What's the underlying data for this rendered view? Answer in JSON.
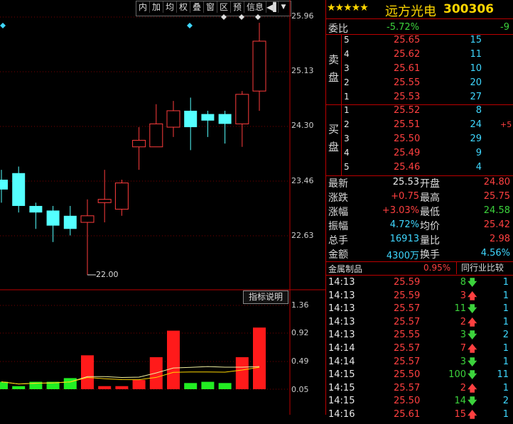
{
  "toolbar": {
    "buttons": [
      "内",
      "加",
      "均",
      "权",
      "叠",
      "窗",
      "区",
      "预",
      "信息"
    ],
    "arrow_label": "▼"
  },
  "chart": {
    "price_ticks": [
      "25.96",
      "25.13",
      "24.30",
      "23.46",
      "22.63"
    ],
    "low_label": "22.00",
    "vol_ticks": [
      "1.36",
      "0.92",
      "0.49",
      "0.05"
    ],
    "indicator_button": "指标说明"
  },
  "chart_data": {
    "type": "candlestick",
    "ylim": [
      22.0,
      25.96
    ],
    "candles": [
      {
        "open": 23.45,
        "close": 23.3,
        "high": 23.6,
        "low": 23.1
      },
      {
        "open": 23.55,
        "close": 23.05,
        "high": 23.65,
        "low": 22.95
      },
      {
        "open": 23.05,
        "close": 22.95,
        "high": 23.1,
        "low": 22.7
      },
      {
        "open": 22.98,
        "close": 22.75,
        "high": 23.05,
        "low": 22.5
      },
      {
        "open": 22.9,
        "close": 22.7,
        "high": 23.05,
        "low": 22.6
      },
      {
        "open": 22.8,
        "close": 22.9,
        "high": 23.15,
        "low": 22.0
      },
      {
        "open": 23.1,
        "close": 23.15,
        "high": 23.6,
        "low": 22.8
      },
      {
        "open": 23.0,
        "close": 23.4,
        "high": 23.45,
        "low": 22.9
      },
      {
        "open": 23.95,
        "close": 24.05,
        "high": 24.25,
        "low": 23.6
      },
      {
        "open": 23.95,
        "close": 24.3,
        "high": 24.6,
        "low": 23.95
      },
      {
        "open": 24.25,
        "close": 24.5,
        "high": 24.65,
        "low": 24.1
      },
      {
        "open": 24.5,
        "close": 24.25,
        "high": 24.7,
        "low": 23.9
      },
      {
        "open": 24.45,
        "close": 24.35,
        "high": 24.5,
        "low": 24.1
      },
      {
        "open": 24.45,
        "close": 24.3,
        "high": 24.5,
        "low": 24.0
      },
      {
        "open": 24.3,
        "close": 24.75,
        "high": 24.8,
        "low": 23.95
      },
      {
        "open": 24.8,
        "close": 25.56,
        "high": 25.84,
        "low": 24.5
      }
    ],
    "volumes": [
      0.12,
      0.05,
      0.12,
      0.12,
      0.18,
      0.55,
      0.05,
      0.05,
      0.15,
      0.52,
      0.95,
      0.1,
      0.12,
      0.1,
      0.52,
      1.0
    ],
    "volume_ylim": [
      0.0,
      1.36
    ]
  },
  "header": {
    "stars": "★★★★★",
    "name": "远方光电",
    "code": "300306"
  },
  "weibi": {
    "label": "委比",
    "value": "-5.72%",
    "diff": "-9"
  },
  "sell": {
    "label": "卖盘",
    "rows": [
      {
        "n": "5",
        "price": "25.65",
        "vol": "15"
      },
      {
        "n": "4",
        "price": "25.62",
        "vol": "11"
      },
      {
        "n": "3",
        "price": "25.61",
        "vol": "10"
      },
      {
        "n": "2",
        "price": "25.55",
        "vol": "20"
      },
      {
        "n": "1",
        "price": "25.53",
        "vol": "27"
      }
    ]
  },
  "buy": {
    "label": "买盘",
    "rows": [
      {
        "n": "1",
        "price": "25.52",
        "vol": "8",
        "chg": ""
      },
      {
        "n": "2",
        "price": "25.51",
        "vol": "24",
        "chg": "+5"
      },
      {
        "n": "3",
        "price": "25.50",
        "vol": "29",
        "chg": ""
      },
      {
        "n": "4",
        "price": "25.49",
        "vol": "9",
        "chg": ""
      },
      {
        "n": "5",
        "price": "25.46",
        "vol": "4",
        "chg": ""
      }
    ]
  },
  "quote": {
    "last_label": "最新",
    "last": "25.53",
    "open_label": "开盘",
    "open": "24.80",
    "chg_label": "涨跌",
    "chg": "+0.75",
    "high_label": "最高",
    "high": "25.75",
    "pct_label": "涨幅",
    "pct": "+3.03%",
    "low_label": "最低",
    "low": "24.58",
    "amp_label": "振幅",
    "amp": "4.72%",
    "avg_label": "均价",
    "avg": "25.42",
    "vol_label": "总手",
    "vol": "16913",
    "vr_label": "量比",
    "vr": "2.98",
    "amt_label": "金额",
    "amt": "4300万",
    "turn_label": "换手",
    "turn": "4.56%"
  },
  "industry": {
    "name": "金属制品",
    "pct": "0.95%",
    "compare": "同行业比较"
  },
  "ticks": [
    {
      "t": "14:13",
      "p": "25.59",
      "v": "8",
      "d": "dn",
      "x": "1"
    },
    {
      "t": "14:13",
      "p": "25.59",
      "v": "3",
      "d": "up",
      "x": "1"
    },
    {
      "t": "14:13",
      "p": "25.57",
      "v": "11",
      "d": "dn",
      "x": "1"
    },
    {
      "t": "14:13",
      "p": "25.57",
      "v": "2",
      "d": "up",
      "x": "1"
    },
    {
      "t": "14:13",
      "p": "25.55",
      "v": "3",
      "d": "dn",
      "x": "2"
    },
    {
      "t": "14:14",
      "p": "25.57",
      "v": "7",
      "d": "up",
      "x": "1"
    },
    {
      "t": "14:14",
      "p": "25.57",
      "v": "3",
      "d": "dn",
      "x": "1"
    },
    {
      "t": "14:15",
      "p": "25.50",
      "v": "100",
      "d": "dn",
      "x": "11"
    },
    {
      "t": "14:15",
      "p": "25.57",
      "v": "2",
      "d": "up",
      "x": "1"
    },
    {
      "t": "14:15",
      "p": "25.50",
      "v": "14",
      "d": "dn",
      "x": "2"
    },
    {
      "t": "14:16",
      "p": "25.61",
      "v": "15",
      "d": "up",
      "x": "1"
    }
  ]
}
